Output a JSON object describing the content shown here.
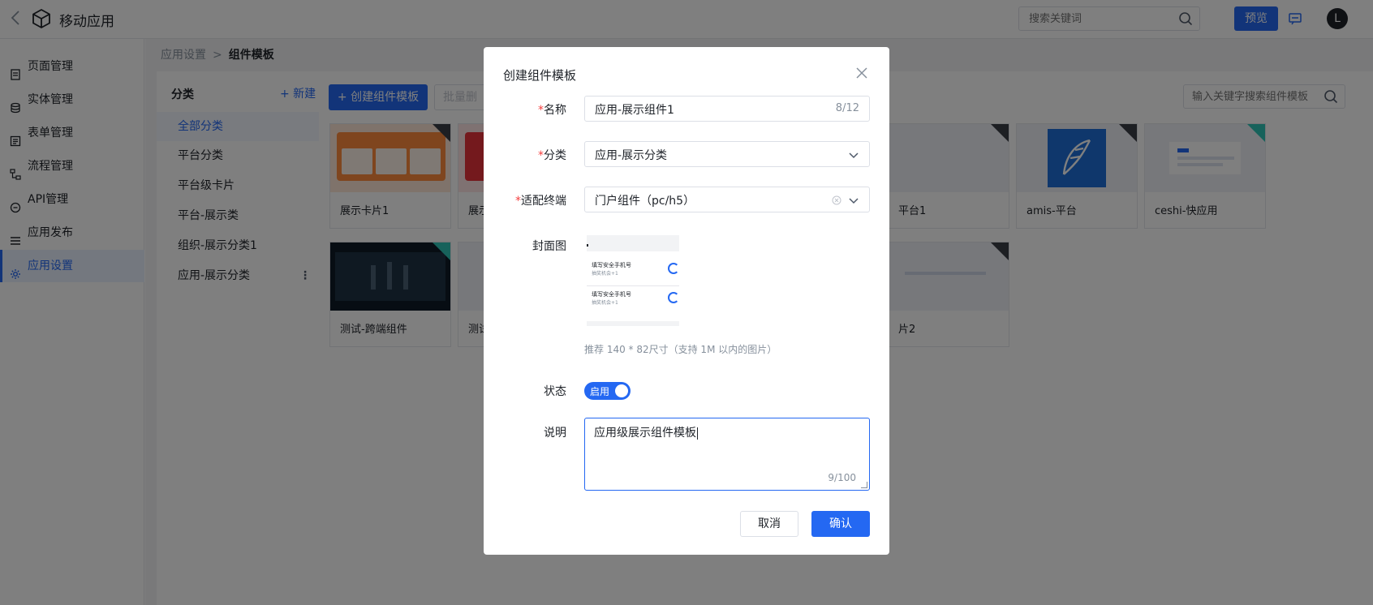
{
  "header": {
    "title": "移动应用",
    "search_placeholder": "搜索关键词",
    "preview_label": "预览",
    "avatar_letter": "L"
  },
  "sidebar": {
    "items": [
      {
        "label": "页面管理",
        "icon": "page-icon"
      },
      {
        "label": "实体管理",
        "icon": "database-icon"
      },
      {
        "label": "表单管理",
        "icon": "form-icon"
      },
      {
        "label": "流程管理",
        "icon": "flow-icon"
      },
      {
        "label": "API管理",
        "icon": "api-icon"
      },
      {
        "label": "应用发布",
        "icon": "publish-icon"
      },
      {
        "label": "应用设置",
        "icon": "gear-icon",
        "active": true
      }
    ]
  },
  "breadcrumb": {
    "parent": "应用设置",
    "separator": ">",
    "current": "组件模板"
  },
  "categories": {
    "heading": "分类",
    "new_label": "+ 新建",
    "items": [
      {
        "label": "全部分类",
        "active": true
      },
      {
        "label": "平台分类"
      },
      {
        "label": "平台级卡片"
      },
      {
        "label": "平台-展示类"
      },
      {
        "label": "组织-展示分类1"
      },
      {
        "label": "应用-展示分类",
        "more": "⋮"
      }
    ]
  },
  "content": {
    "create_label": "+ 创建组件模板",
    "batch_label": "批量删",
    "search_placeholder": "输入关键字搜索组件模板",
    "cards": [
      {
        "title": "展示卡片1"
      },
      {
        "title": "展示"
      },
      {
        "title": "平台1"
      },
      {
        "title": "amis-平台"
      },
      {
        "title": "ceshi-快应用"
      },
      {
        "title": "测试-跨端组件"
      },
      {
        "title": "测试"
      },
      {
        "title": "片2"
      }
    ]
  },
  "modal": {
    "title": "创建组件模板",
    "name_label": "名称",
    "name_value": "应用-展示组件1",
    "name_count": "8/12",
    "category_label": "分类",
    "category_value": "应用-展示分类",
    "terminal_label": "适配终端",
    "terminal_value": "门户组件（pc/h5）",
    "cover_label": "封面图",
    "cover_row_title": "填写安全手机号",
    "cover_row_sub": "抽奖机会+1",
    "cover_hint": "推荐 140 * 82尺寸（支持 1M 以内的图片）",
    "status_label": "状态",
    "status_value": "启用",
    "desc_label": "说明",
    "desc_value": "应用级展示组件模板",
    "desc_count": "9/100",
    "cancel_label": "取消",
    "ok_label": "确认",
    "required_mark": "*"
  },
  "colors": {
    "primary": "#2468f2",
    "required": "#f53f3f",
    "overlay": "rgba(0,0,0,0.5)"
  }
}
